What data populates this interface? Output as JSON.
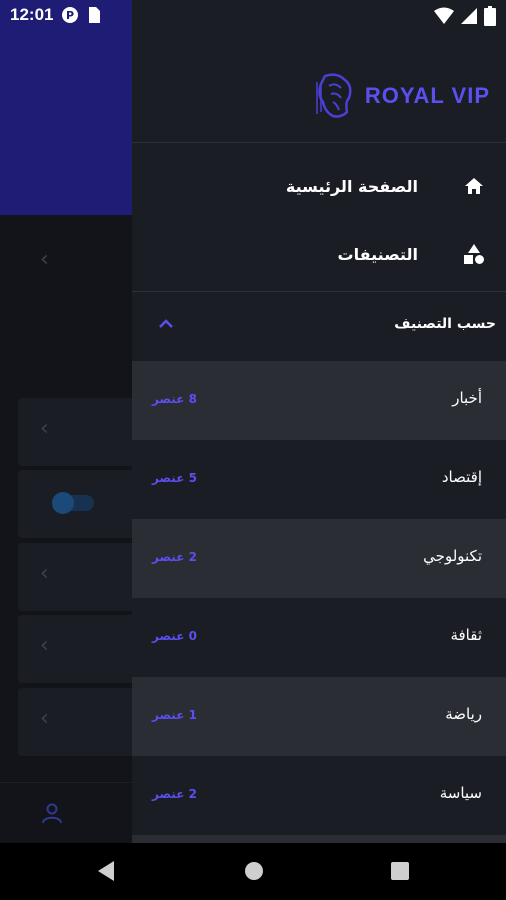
{
  "status_bar": {
    "time": "12:01",
    "icons": [
      "notification-icon",
      "sim-card-icon",
      "wifi-icon",
      "signal-icon",
      "battery-icon"
    ]
  },
  "drawer": {
    "logo_text": "ROYAL VIP",
    "nav_items": [
      {
        "label": "الصفحة الرئيسية",
        "icon": "home-icon"
      },
      {
        "label": "التصنيفات",
        "icon": "categories-icon"
      }
    ],
    "section_title": "حسب التصنيف",
    "categories": [
      {
        "name": "أخبار",
        "count": "8 عنصر"
      },
      {
        "name": "إقتصاد",
        "count": "5 عنصر"
      },
      {
        "name": "تكنولوجي",
        "count": "2 عنصر"
      },
      {
        "name": "ثقافة",
        "count": "0 عنصر"
      },
      {
        "name": "رياضة",
        "count": "1 عنصر"
      },
      {
        "name": "سياسة",
        "count": "2 عنصر"
      }
    ]
  },
  "colors": {
    "accent": "#5b4ff0",
    "drawer_bg": "#1b1d24",
    "alt_row_bg": "#2a2d34",
    "header_bg": "#1f1c75"
  },
  "navigation_bar": {
    "buttons": [
      "back-icon",
      "home-circle-icon",
      "recents-icon"
    ]
  }
}
